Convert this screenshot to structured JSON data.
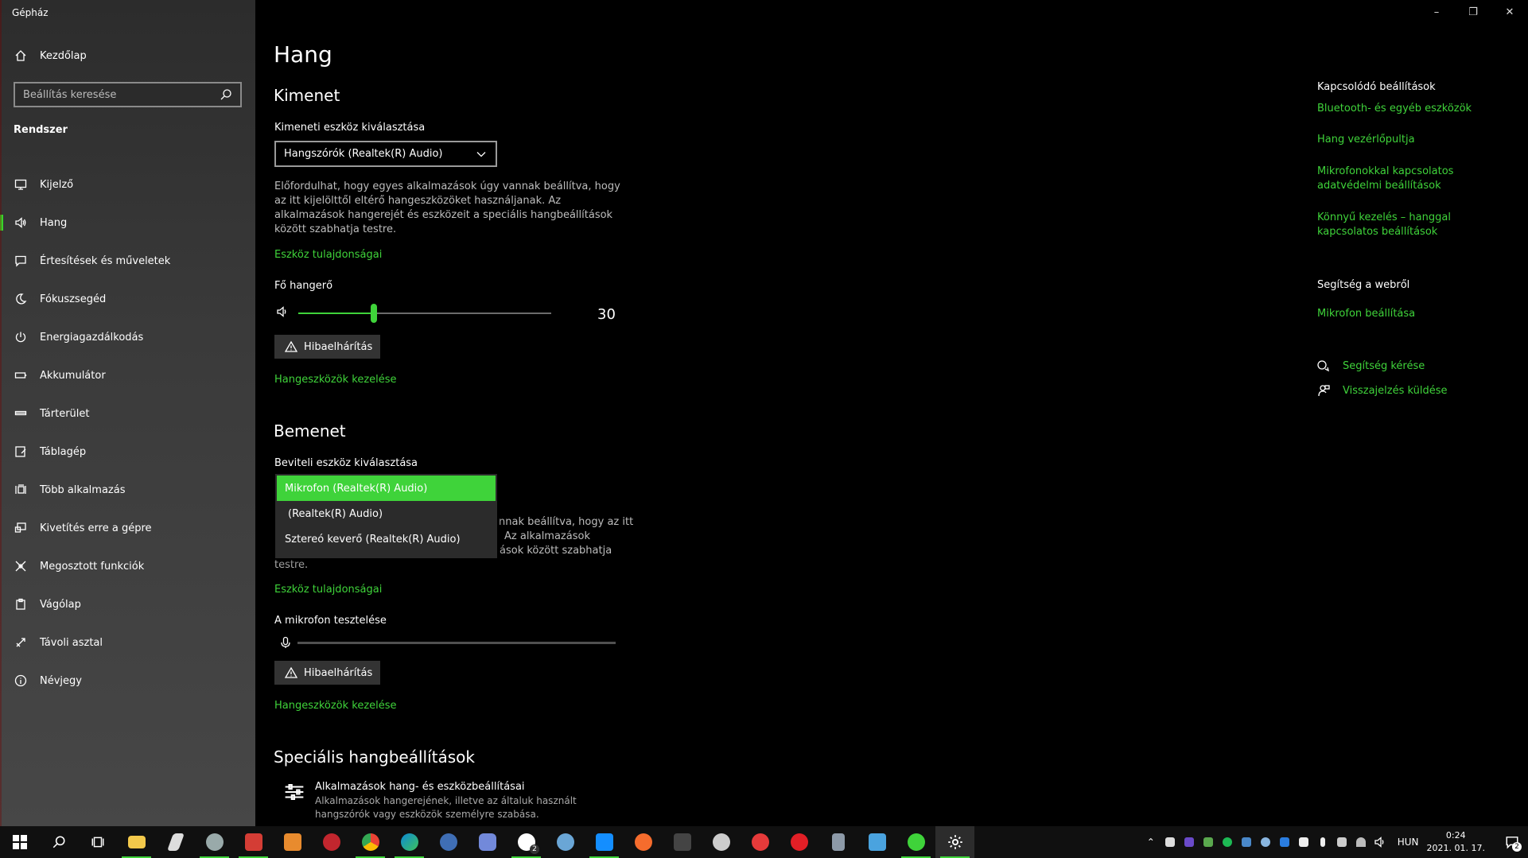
{
  "window": {
    "title": "Gépház"
  },
  "sidebar": {
    "home": "Kezdőlap",
    "search_placeholder": "Beállítás keresése",
    "section": "Rendszer",
    "items": [
      {
        "label": "Kijelző",
        "icon": "monitor-icon"
      },
      {
        "label": "Hang",
        "icon": "speaker-icon",
        "active": true
      },
      {
        "label": "Értesítések és műveletek",
        "icon": "notification-icon"
      },
      {
        "label": "Fókuszsegéd",
        "icon": "moon-icon"
      },
      {
        "label": "Energiagazdálkodás",
        "icon": "power-icon"
      },
      {
        "label": "Akkumulátor",
        "icon": "battery-icon"
      },
      {
        "label": "Tárterület",
        "icon": "storage-icon"
      },
      {
        "label": "Táblagép",
        "icon": "tablet-icon"
      },
      {
        "label": "Több alkalmazás",
        "icon": "multitask-icon"
      },
      {
        "label": "Kivetítés erre a gépre",
        "icon": "project-icon"
      },
      {
        "label": "Megosztott funkciók",
        "icon": "shared-icon"
      },
      {
        "label": "Vágólap",
        "icon": "clipboard-icon"
      },
      {
        "label": "Távoli asztal",
        "icon": "remote-icon"
      },
      {
        "label": "Névjegy",
        "icon": "info-icon"
      }
    ]
  },
  "main": {
    "title": "Hang",
    "output": {
      "heading": "Kimenet",
      "select_label": "Kimeneti eszköz kiválasztása",
      "selected_device": "Hangszórók (Realtek(R) Audio)",
      "description": "Előfordulhat, hogy egyes alkalmazások úgy vannak beállítva, hogy az itt kijelölttől eltérő hangeszközöket használjanak. Az alkalmazások hangerejét és eszközeit a speciális hangbeállítások között szabhatja testre.",
      "device_props_link": "Eszköz tulajdonságai",
      "volume_label": "Fő hangerő",
      "volume_value": "30",
      "volume_level": 0.3,
      "troubleshoot_label": "Hibaelhárítás",
      "manage_link": "Hangeszközök kezelése"
    },
    "input": {
      "heading": "Bemenet",
      "select_label": "Beviteli eszköz kiválasztása",
      "dropdown_options": [
        "Mikrofon (Realtek(R) Audio)",
        "(Realtek(R) Audio)",
        "Sztereó keverő (Realtek(R) Audio)"
      ],
      "description_fragment_1": "nnak beállítva, hogy az itt",
      "description_fragment_2": "Az alkalmazások",
      "description_fragment_3": "ások között szabhatja",
      "description_end": "testre.",
      "device_props_link": "Eszköz tulajdonságai",
      "mic_test_label": "A mikrofon tesztelése",
      "troubleshoot_label": "Hibaelhárítás",
      "manage_link": "Hangeszközök kezelése"
    },
    "advanced": {
      "heading": "Speciális hangbeállítások",
      "app_title": "Alkalmazások hang- és eszközbeállításai",
      "app_desc": "Alkalmazások hangerejének, illetve az általuk használt hangszórók vagy eszközök személyre szabása."
    }
  },
  "right": {
    "related_heading": "Kapcsolódó beállítások",
    "related_links": [
      "Bluetooth- és egyéb eszközök",
      "Hang vezérlőpultja",
      "Mikrofonokkal kapcsolatos adatvédelmi beállítások",
      "Könnyű kezelés – hanggal kapcsolatos beállítások"
    ],
    "help_heading": "Segítség a webről",
    "help_links": [
      "Mikrofon beállítása"
    ],
    "get_help": "Segítség kérése",
    "feedback": "Visszajelzés küldése"
  },
  "taskbar": {
    "lang": "HUN",
    "time": "0:24",
    "date": "2021. 01. 17.",
    "notification_count": "2",
    "xbox_badge": "2"
  },
  "colors": {
    "accent": "#3fd33a",
    "background": "#000000"
  }
}
